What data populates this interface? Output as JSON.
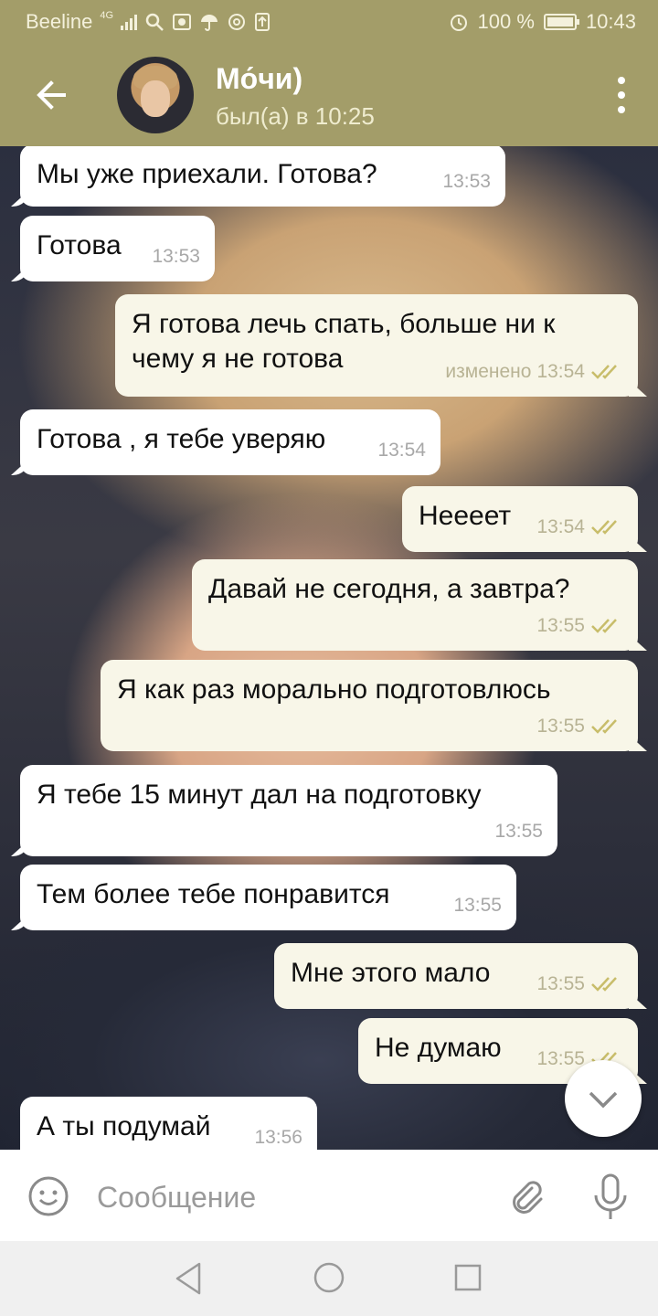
{
  "status_bar": {
    "carrier": "Beeline",
    "network": "4G",
    "battery": "100 %",
    "time": "10:43"
  },
  "header": {
    "contact_name": "Мо́чи)",
    "last_seen": "был(а) в 10:25",
    "icons": [
      "back-arrow-icon",
      "avatar",
      "more-vert-icon"
    ],
    "accent_color": "#a39d69"
  },
  "messages": [
    {
      "dir": "in",
      "text": "Мы уже приехали. Готова?",
      "time": "13:53"
    },
    {
      "dir": "in",
      "text": "Готова",
      "time": "13:53"
    },
    {
      "dir": "out",
      "text": "Я готова лечь спать, больше ни к чему я не готова",
      "edited": "изменено",
      "time": "13:54",
      "read": true
    },
    {
      "dir": "in",
      "text": "Готова , я тебе уверяю",
      "time": "13:54"
    },
    {
      "dir": "out",
      "text": "Неееет",
      "time": "13:54",
      "read": true
    },
    {
      "dir": "out",
      "text": "Давай не сегодня, а завтра?",
      "time": "13:55",
      "read": true
    },
    {
      "dir": "out",
      "text": "Я как раз морально подготовлюсь",
      "time": "13:55",
      "read": true
    },
    {
      "dir": "in",
      "text": "Я тебе 15 минут дал на подготовку",
      "time": "13:55"
    },
    {
      "dir": "in",
      "text": "Тем более тебе понравится",
      "time": "13:55"
    },
    {
      "dir": "out",
      "text": "Мне этого мало",
      "time": "13:55",
      "read": true
    },
    {
      "dir": "out",
      "text": "Не думаю",
      "time": "13:55",
      "read": true
    },
    {
      "dir": "in",
      "text": "А ты подумай",
      "time": "13:56"
    }
  ],
  "input": {
    "placeholder": "Сообщение",
    "value": ""
  }
}
